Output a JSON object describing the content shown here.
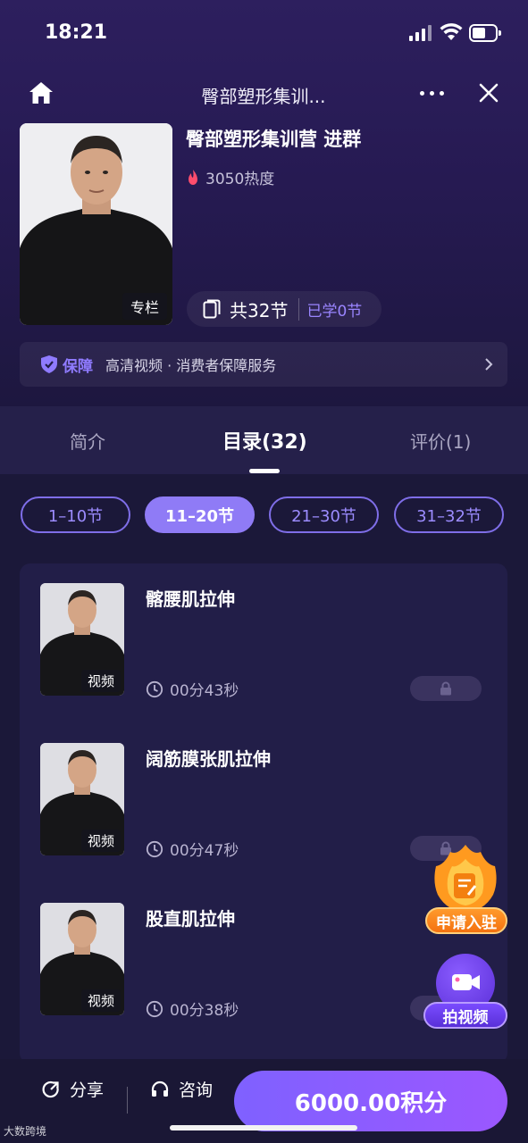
{
  "status_bar": {
    "time": "18:21"
  },
  "nav": {
    "title": "臀部塑形集训..."
  },
  "course": {
    "title": "臀部塑形集训营 进群",
    "cover_tag": "专栏",
    "heat": "3050热度",
    "lessons_total": "共32节",
    "lessons_learned": "已学0节"
  },
  "guarantee": {
    "brand": "保障",
    "text": "高清视频 · 消费者保障服务"
  },
  "tabs": [
    {
      "label": "简介"
    },
    {
      "label": "目录(32)"
    },
    {
      "label": "评价(1)"
    }
  ],
  "segments": [
    {
      "label": "1–10节"
    },
    {
      "label": "11–20节"
    },
    {
      "label": "21–30节"
    },
    {
      "label": "31–32节"
    }
  ],
  "lessons": [
    {
      "title": "髂腰肌拉伸",
      "tag": "视频",
      "duration": "00分43秒"
    },
    {
      "title": "阔筋膜张肌拉伸",
      "tag": "视频",
      "duration": "00分47秒"
    },
    {
      "title": "股直肌拉伸",
      "tag": "视频",
      "duration": "00分38秒"
    }
  ],
  "floating": {
    "apply_label": "申请入驻",
    "video_label": "拍视频"
  },
  "bottom": {
    "share": "分享",
    "consult": "咨询",
    "price_button": "6000.00积分"
  },
  "watermark": "大数跨境",
  "colors": {
    "accent": "#8f7bf6",
    "background": "#1b1839",
    "buy_button": "#8a5cff",
    "flame": "#ff4d6d"
  }
}
